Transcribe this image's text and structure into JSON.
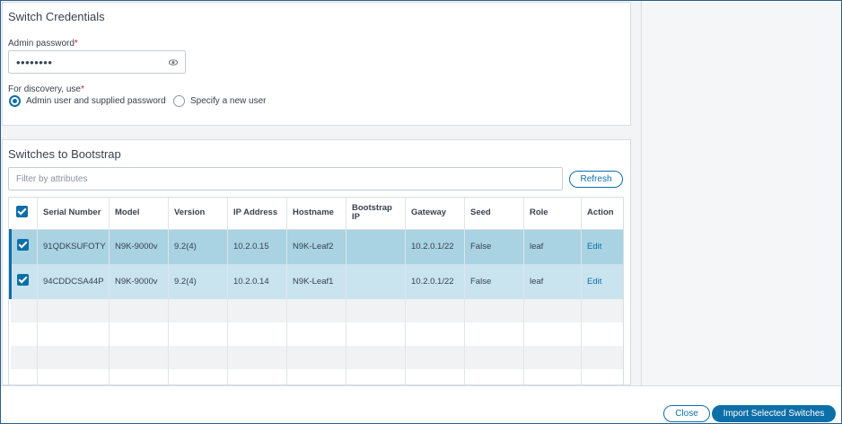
{
  "credentials": {
    "title": "Switch Credentials",
    "admin_password_label": "Admin password",
    "required_mark": "*",
    "admin_password_value": "••••••••",
    "discovery_label": "For discovery, use",
    "radio_admin": "Admin user and supplied password",
    "radio_new": "Specify a new user",
    "selected_option": "admin"
  },
  "bootstrap": {
    "title": "Switches to Bootstrap",
    "filter_placeholder": "Filter by attributes",
    "refresh_label": "Refresh",
    "columns": [
      "Serial Number",
      "Model",
      "Version",
      "IP Address",
      "Hostname",
      "Bootstrap IP",
      "Gateway",
      "Seed",
      "Role",
      "Action"
    ],
    "rows": [
      {
        "serial": "91QDKSUFOTY",
        "model": "N9K-9000v",
        "version": "9.2(4)",
        "ip": "10.2.0.15",
        "hostname": "N9K-Leaf2",
        "bootstrap_ip": "",
        "gateway": "10.2.0.1/22",
        "seed": "False",
        "role": "leaf",
        "action": "Edit"
      },
      {
        "serial": "94CDDCSA44P",
        "model": "N9K-9000v",
        "version": "9.2(4)",
        "ip": "10.2.0.14",
        "hostname": "N9K-Leaf1",
        "bootstrap_ip": "",
        "gateway": "10.2.0.1/22",
        "seed": "False",
        "role": "leaf",
        "action": "Edit"
      }
    ]
  },
  "footer": {
    "close_label": "Close",
    "import_label": "Import Selected Switches"
  },
  "colors": {
    "accent": "#0d6fa8",
    "selected_row": "#a9d2e3",
    "selected_row_2": "#c9e4ef",
    "required": "#cf2030"
  }
}
